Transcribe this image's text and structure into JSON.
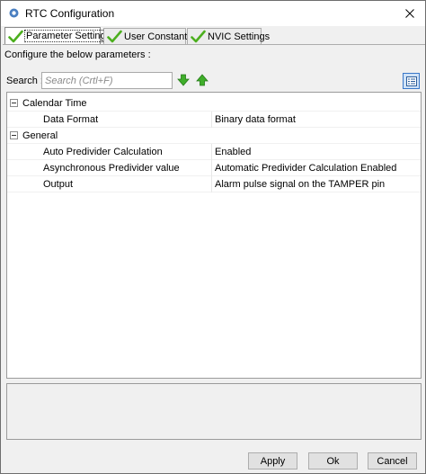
{
  "window": {
    "title": "RTC Configuration"
  },
  "tabs": [
    {
      "label": "Parameter Settings",
      "active": true
    },
    {
      "label": "User Constants",
      "active": false
    },
    {
      "label": "NVIC Settings",
      "active": false
    }
  ],
  "panel": {
    "configure_label": "Configure the below parameters :",
    "search_label": "Search :",
    "search_placeholder": "Search (Crtl+F)",
    "search_value": ""
  },
  "tree": {
    "groups": [
      {
        "name": "Calendar Time",
        "expanded": true,
        "params": [
          {
            "name": "Data Format",
            "value": "Binary data format"
          }
        ]
      },
      {
        "name": "General",
        "expanded": true,
        "params": [
          {
            "name": "Auto Predivider Calculation",
            "value": "Enabled"
          },
          {
            "name": "Asynchronous Predivider value",
            "value": "Automatic Predivider Calculation Enabled"
          },
          {
            "name": "Output",
            "value": "Alarm pulse signal on the TAMPER pin"
          }
        ]
      }
    ]
  },
  "buttons": {
    "apply": "Apply",
    "ok": "Ok",
    "cancel": "Cancel"
  },
  "colors": {
    "check_green": "#4caf1e",
    "arrow_green": "#3fae2a",
    "selection_blue": "#3a78c9"
  }
}
